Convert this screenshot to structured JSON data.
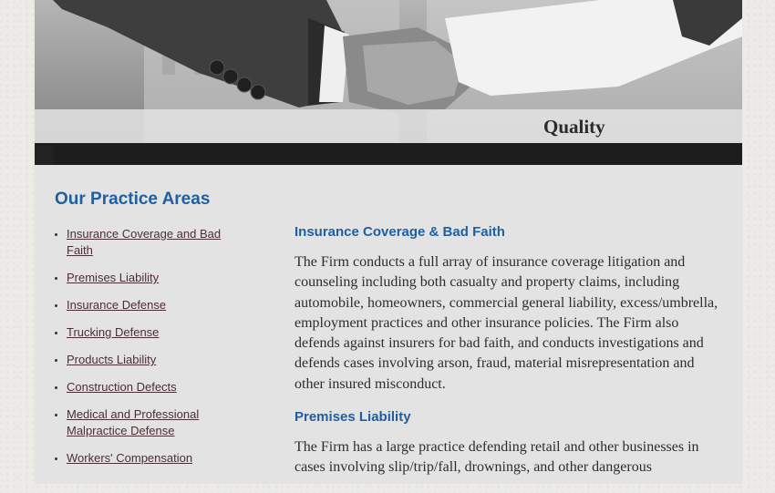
{
  "hero": {
    "caption": "Quality",
    "image_subject": "handshake-photo"
  },
  "sidebar": {
    "title": "Our Practice Areas",
    "items": [
      {
        "label": "Insurance Coverage and Bad Faith"
      },
      {
        "label": "Premises Liability"
      },
      {
        "label": "Insurance Defense"
      },
      {
        "label": "Trucking Defense"
      },
      {
        "label": "Products Liability"
      },
      {
        "label": "Construction Defects"
      },
      {
        "label": "Medical and Professional Malpractice Defense"
      },
      {
        "label": "Workers' Compensation"
      }
    ]
  },
  "main": {
    "sections": [
      {
        "heading": "Insurance Coverage & Bad Faith",
        "body": "The Firm conducts a full array of insurance coverage litigation and counseling including both casualty and property claims, including automobile, homeowners, commercial general liability, excess/umbrella, employment practices and other insurance policies. The Firm also defends against insurers for bad faith, and conducts investigations and defends cases involving arson, fraud, material misrepresentation and other insured misconduct."
      },
      {
        "heading": "Premises Liability",
        "body": "The Firm has a large practice defending retail and other businesses in cases involving slip/trip/fall, drownings, and other dangerous"
      }
    ]
  },
  "colors": {
    "heading_blue": "#1f5fa0",
    "link": "#4a2f35",
    "page_bg": "#e3e3e3"
  }
}
